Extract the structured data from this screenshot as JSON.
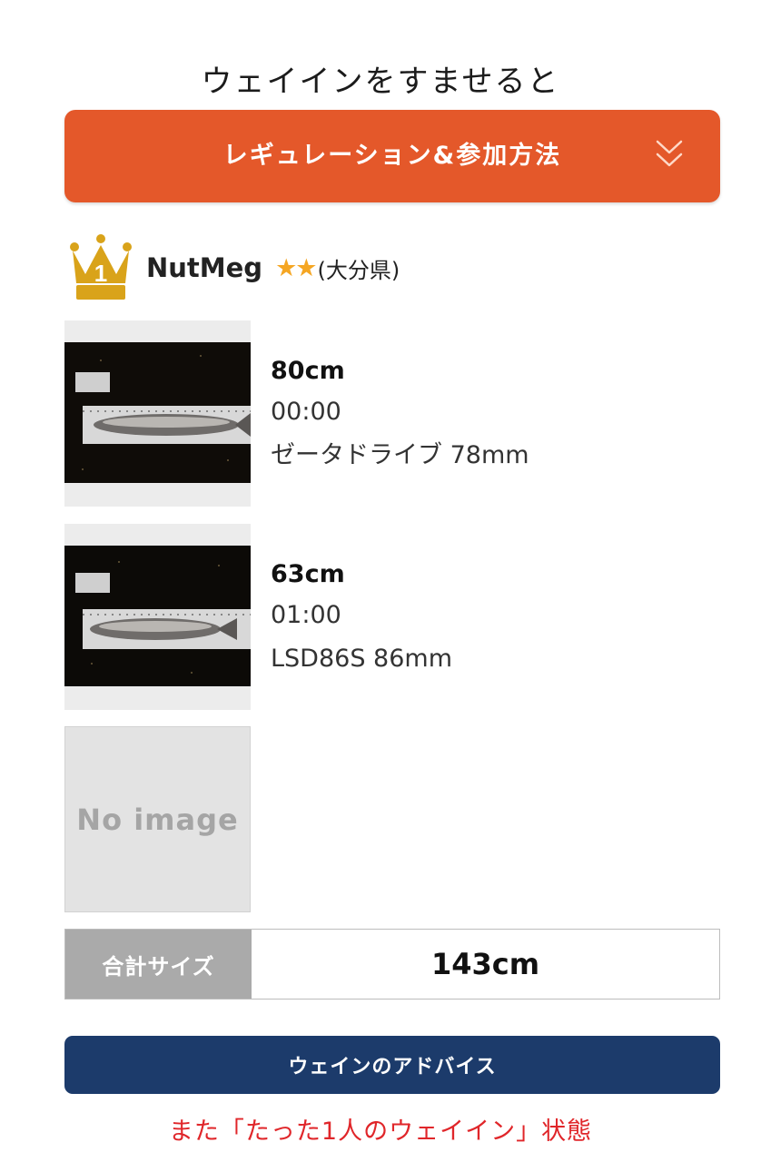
{
  "heading": "ウェイインをすませると",
  "regulation_button": {
    "label": "レギュレーション&参加方法",
    "icon": "double-chevron-down-icon"
  },
  "user": {
    "rank_icon": "crown-rank-1-icon",
    "rank": "1",
    "name": "NutMeg",
    "stars": "★★",
    "prefecture": "(大分県)"
  },
  "catches": [
    {
      "size": "80cm",
      "time": "00:00",
      "lure": "ゼータドライブ 78mm"
    },
    {
      "size": "63cm",
      "time": "01:00",
      "lure": "LSD86S 86mm"
    }
  ],
  "no_image": {
    "text": "No image"
  },
  "total": {
    "label": "合計サイズ",
    "value": "143cm"
  },
  "advice_button": {
    "label": "ウェインのアドバイス"
  },
  "note": "また「たった1人のウェイイン」状態",
  "colors": {
    "regulation_button": "#e4582a",
    "advice_button": "#1c3b6b",
    "note_text": "#e0262a",
    "star": "#f5a623",
    "crown": "#d9a31a",
    "total_label_bg": "#aaaaaa"
  }
}
